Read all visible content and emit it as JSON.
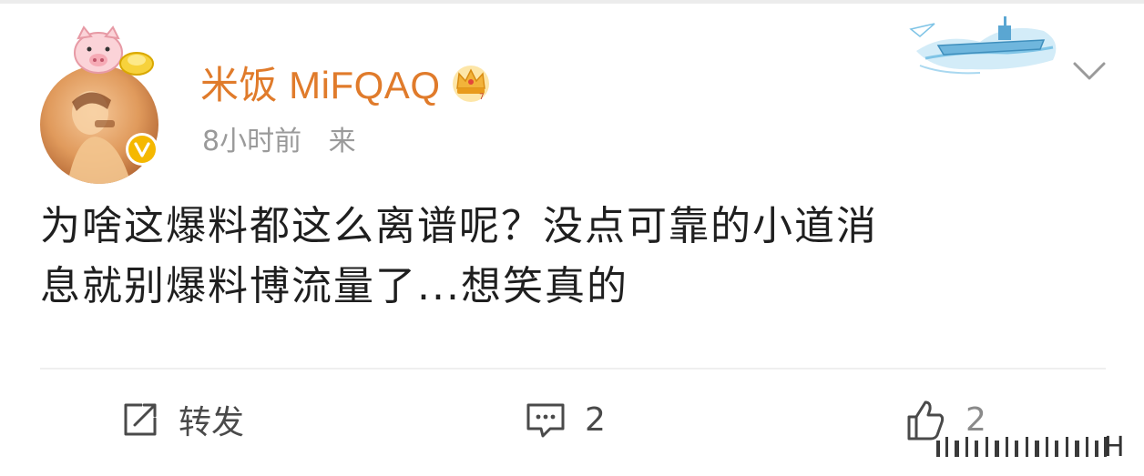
{
  "post": {
    "user": {
      "name": "米饭 MiFQAQ",
      "verified": true
    },
    "meta": {
      "time": "8小时前",
      "source": "来"
    },
    "content": {
      "line1": "为啥这爆料都这么离谱呢？没点可靠的小道消",
      "line2": "息就别爆料博流量了...想笑真的"
    },
    "actions": {
      "repost_label": "转发",
      "comment_count": "2",
      "like_count": "2"
    },
    "watermark_fragment": "H"
  },
  "colors": {
    "username": "#e07b2b",
    "meta": "#9a9a9a",
    "verified_badge": "#f5b800",
    "body_text": "#1f1f1f"
  },
  "icons": [
    "pig-pendant-icon",
    "verified-badge-icon",
    "crown-icon",
    "aircraft-carrier-decoration",
    "chevron-down-icon",
    "repost-icon",
    "comment-icon",
    "like-icon"
  ]
}
